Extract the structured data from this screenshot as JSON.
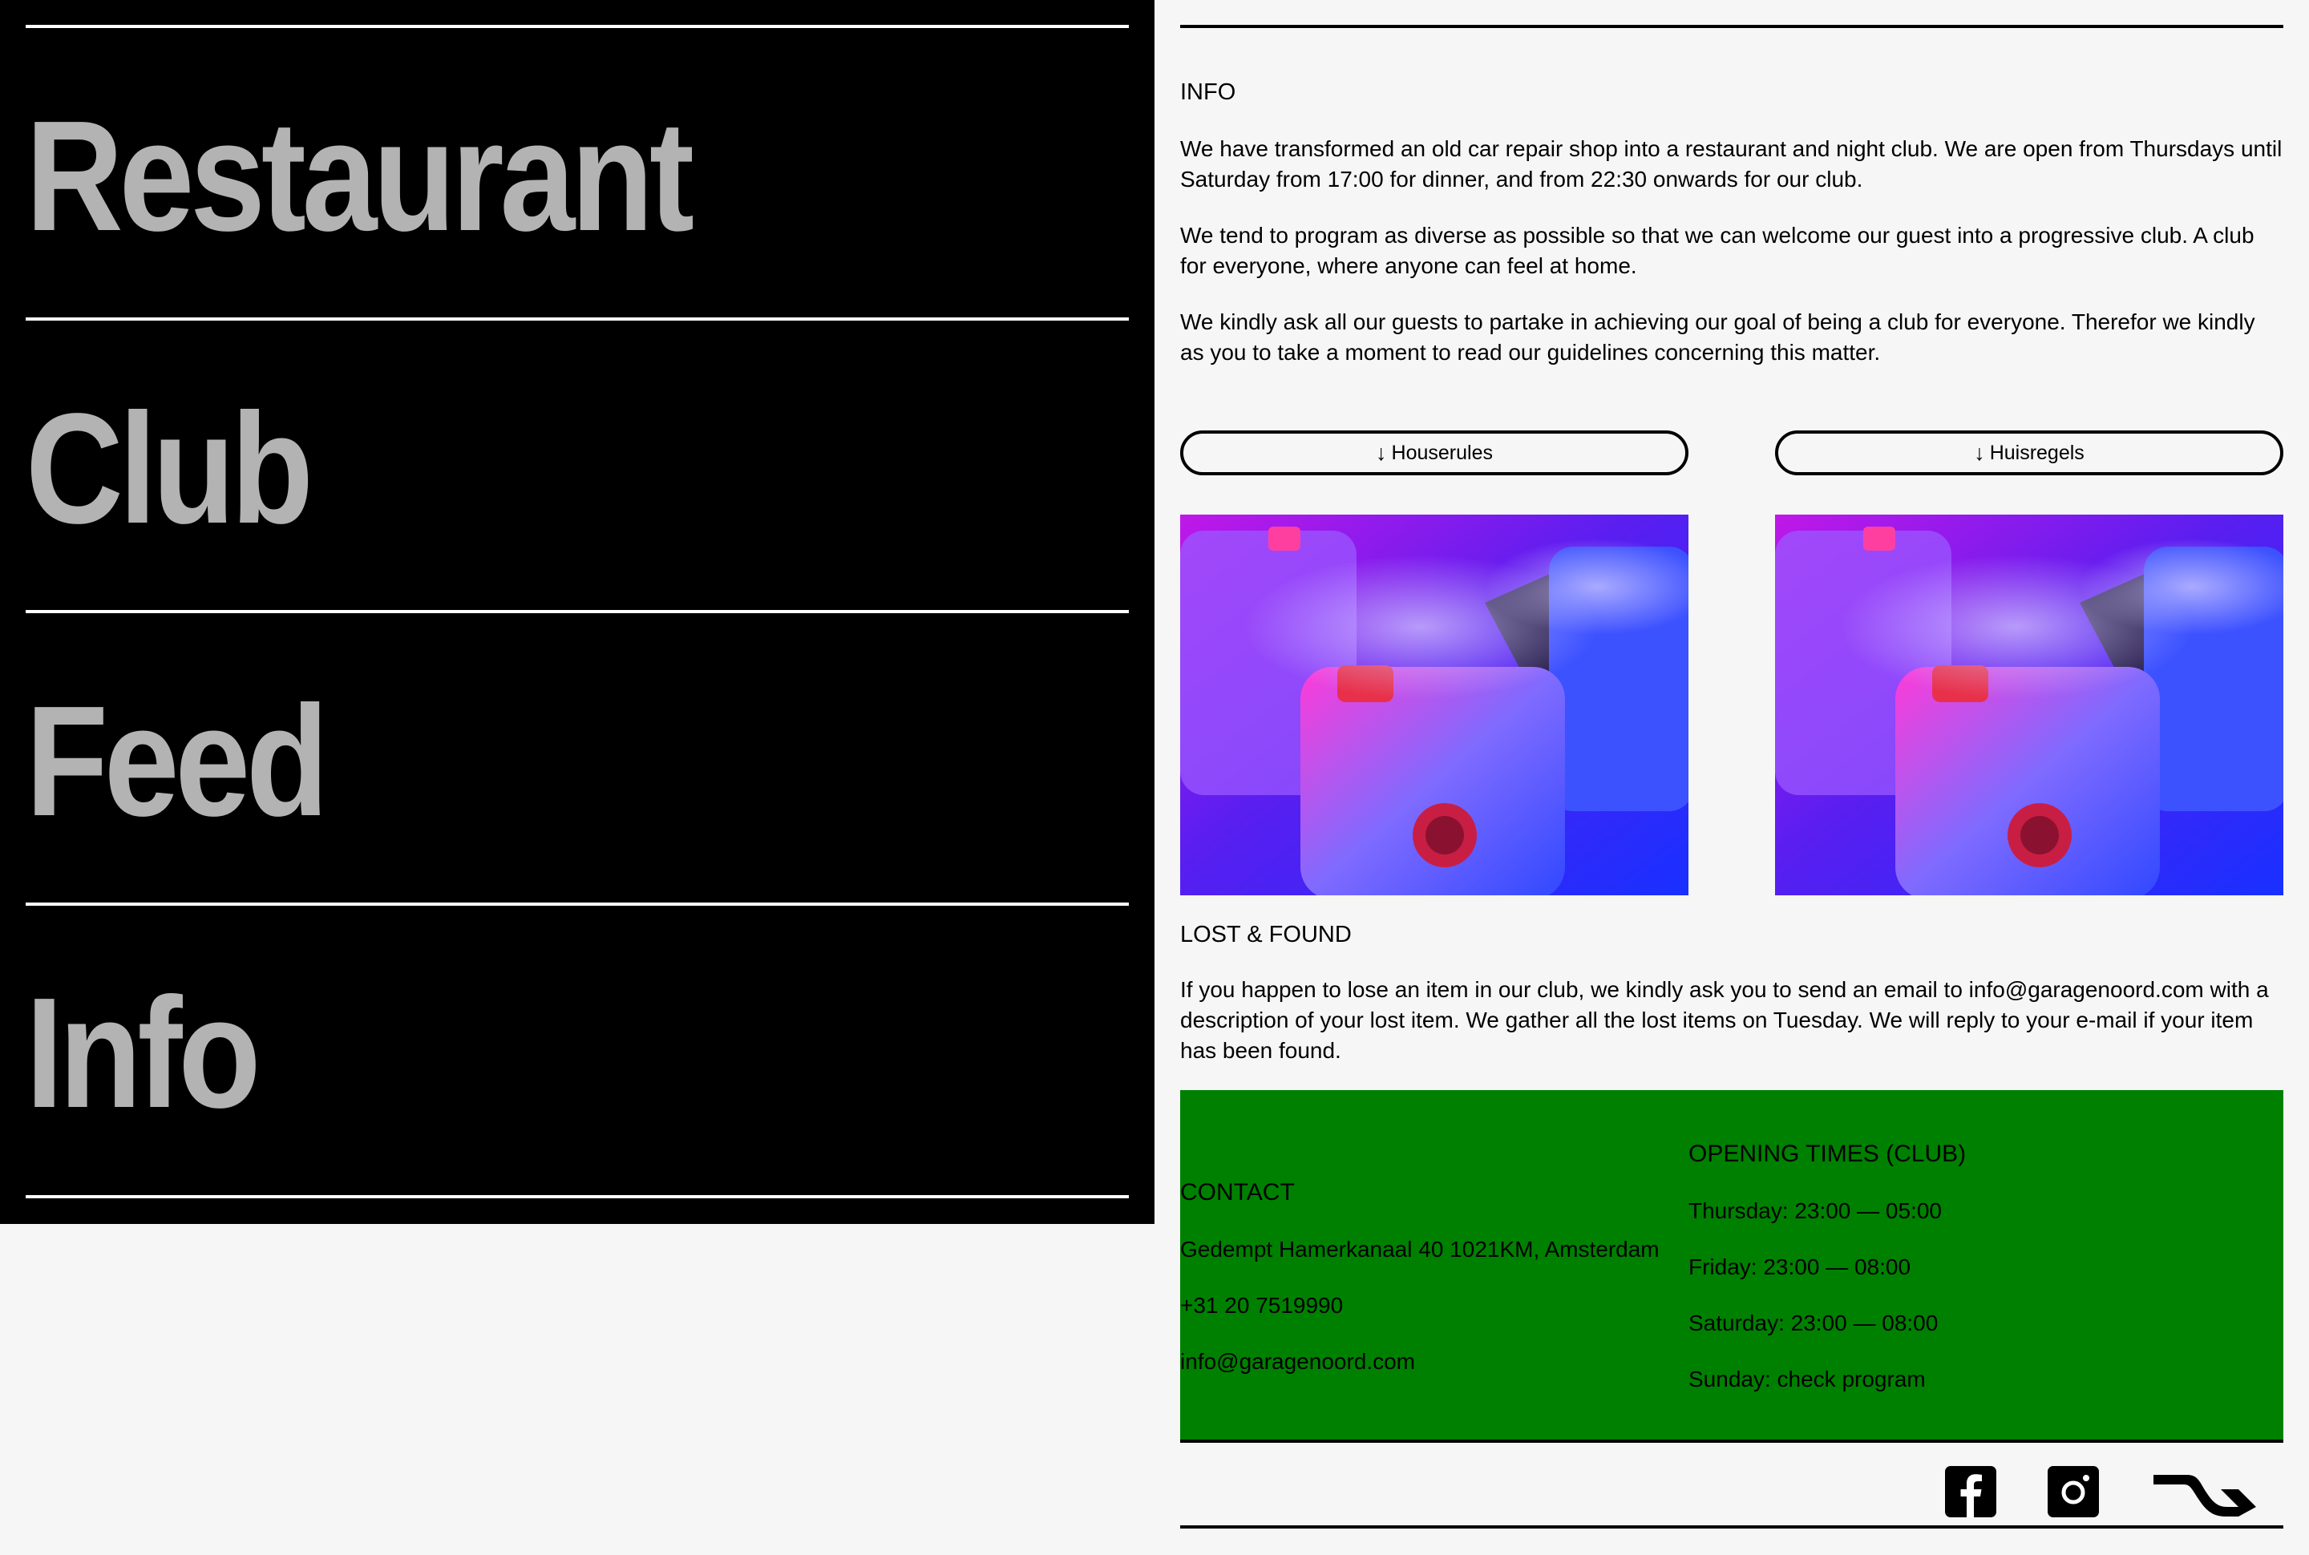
{
  "nav": {
    "items": [
      {
        "label": "Restaurant"
      },
      {
        "label": "Club"
      },
      {
        "label": "Feed"
      },
      {
        "label": "Info"
      }
    ]
  },
  "info": {
    "heading": "INFO",
    "paragraphs": [
      "We have transformed an old car repair shop into a restaurant and night club. We are open from Thursdays until Saturday from 17:00 for dinner, and from 22:30 onwards for our club.",
      "We tend to program as diverse as possible so that we can welcome our guest into a progressive club. A club for everyone, where anyone can feel at home.",
      "We kindly ask all our guests to partake in achieving our goal of being a club for everyone. Therefor we kindly as you to take a moment to read our guidelines concerning this matter."
    ]
  },
  "buttons": {
    "arrow": "↓",
    "houserules": "Houserules",
    "huisregels": "Huisregels"
  },
  "lost_found": {
    "heading": "LOST & FOUND",
    "text": "If you happen to lose an item in our club, we kindly ask you to send an email to info@garagenoord.com with a description of your lost item. We gather all the lost items on Tuesday. We will reply to your e-mail if your item has been found."
  },
  "contact": {
    "heading": "CONTACT",
    "address": "Gedempt Hamerkanaal 40 1021KM, Amsterdam",
    "phone": "+31 20 7519990",
    "email": "info@garagenoord.com"
  },
  "opening": {
    "heading": "OPENING TIMES (CLUB)",
    "lines": [
      "Thursday: 23:00 — 05:00",
      "Friday: 23:00 — 08:00",
      "Saturday: 23:00 — 08:00",
      "Sunday: check program"
    ]
  },
  "colors": {
    "nav_bg": "#000000",
    "nav_text": "#b3b3b3",
    "page_bg": "#f6f6f6",
    "panel_bg": "#008000"
  },
  "icons": {
    "facebook": "facebook-icon",
    "instagram": "instagram-icon",
    "ra": "resident-advisor-icon"
  }
}
